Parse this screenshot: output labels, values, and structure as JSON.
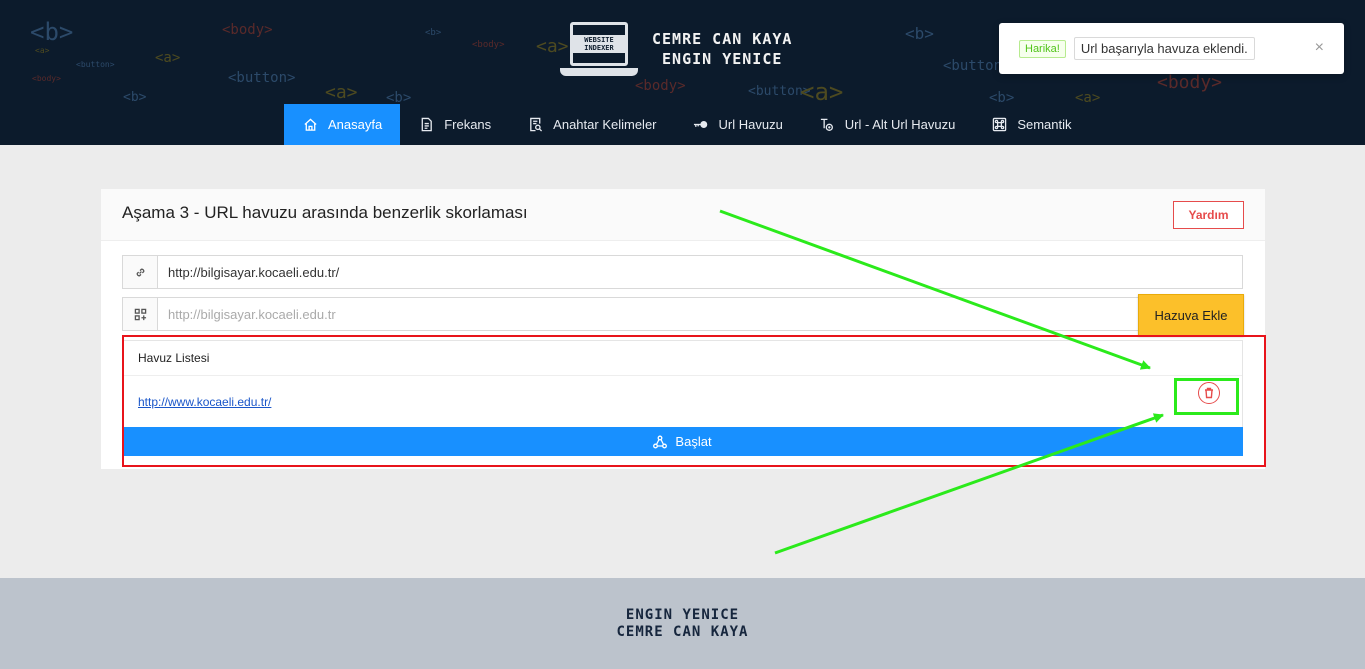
{
  "header": {
    "background_tags": [
      "<b>",
      "<body>",
      "<a>",
      "<button>",
      "<b>",
      "<body>",
      "<a>",
      "<button>",
      "<b>",
      "<a>",
      "<body>",
      "<b>",
      "<a>",
      "<button>",
      "<a>",
      "<body>",
      "<b>",
      "<a>",
      "<button>",
      "<b>",
      "<body>"
    ],
    "logo_text": "WEBSITE INDEXER",
    "brand_line1": "CEMRE CAN KAYA",
    "brand_line2": "ENGIN YENICE"
  },
  "nav": {
    "items": [
      {
        "label": "Anasayfa",
        "icon": "home-icon",
        "active": true
      },
      {
        "label": "Frekans",
        "icon": "file-icon",
        "active": false
      },
      {
        "label": "Anahtar Kelimeler",
        "icon": "file-search-icon",
        "active": false
      },
      {
        "label": "Url Havuzu",
        "icon": "key-icon",
        "active": false
      },
      {
        "label": "Url - Alt Url Havuzu",
        "icon": "cluster-icon",
        "active": false
      },
      {
        "label": "Semantik",
        "icon": "command-icon",
        "active": false
      }
    ]
  },
  "toast": {
    "tag": "Harika!",
    "message": "Url başarıyla havuza eklendi.",
    "close": "×"
  },
  "card": {
    "title": "Aşama 3 - URL havuzu arasında benzerlik skorlaması",
    "help_button": "Yardım",
    "url_input": {
      "value": "http://bilgisayar.kocaeli.edu.tr/",
      "icon": "link-icon"
    },
    "pool_input": {
      "value": "",
      "placeholder": "http://bilgisayar.kocaeli.edu.tr",
      "icon": "append-icon"
    },
    "add_button": "Hazuva Ekle",
    "pool": {
      "header": "Havuz Listesi",
      "items": [
        "http://www.kocaeli.edu.tr/"
      ],
      "delete_icon": "trash-icon"
    },
    "start_button": "Başlat",
    "start_icon": "deployment-icon"
  },
  "colors": {
    "header_bg": "#0c1b2c",
    "primary": "#1890ff",
    "warning": "#fcc02a",
    "danger": "#e64b4b",
    "annotation_red": "#e8141b",
    "annotation_green": "#2bea1b"
  },
  "footer": {
    "line1": "ENGIN YENICE",
    "line2": "CEMRE CAN KAYA"
  }
}
